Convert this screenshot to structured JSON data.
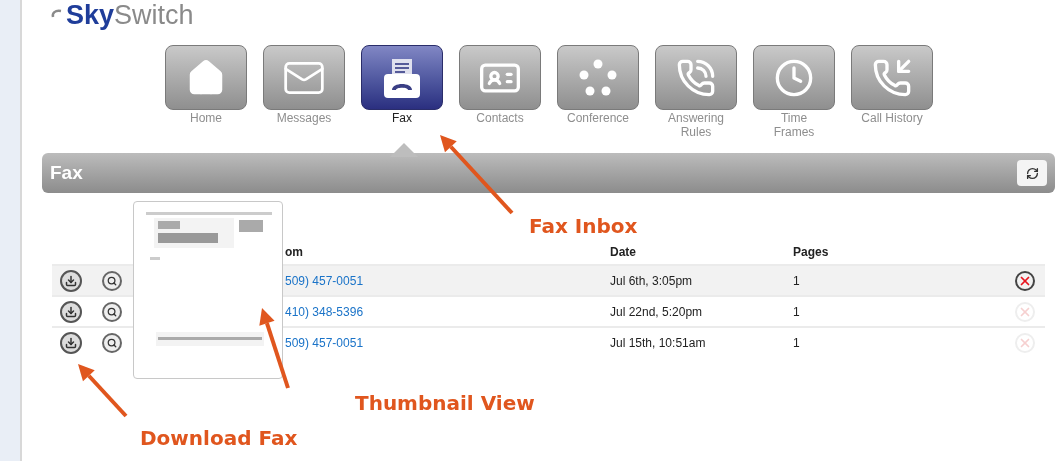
{
  "logo": {
    "brand_bold": "Sky",
    "brand_rest": "Switch"
  },
  "nav": [
    {
      "label": "Home",
      "kind": "home",
      "selected": false
    },
    {
      "label": "Messages",
      "kind": "mail",
      "selected": false
    },
    {
      "label": "Fax",
      "kind": "fax",
      "selected": true
    },
    {
      "label": "Contacts",
      "kind": "contact",
      "selected": false
    },
    {
      "label": "Conference",
      "kind": "conference",
      "selected": false
    },
    {
      "label": "Answering Rules",
      "kind": "answering",
      "selected": false
    },
    {
      "label": "Time Frames",
      "kind": "clock",
      "selected": false
    },
    {
      "label": "Call History",
      "kind": "history",
      "selected": false
    }
  ],
  "panel": {
    "title": "Fax"
  },
  "table": {
    "columns": [
      "om",
      "Date",
      "Pages"
    ],
    "rows": [
      {
        "from": "509) 457-0051",
        "date": "Jul 6th, 3:05pm",
        "pages": "1",
        "selected": true
      },
      {
        "from": "410) 348-5396",
        "date": "Jul 22nd, 5:20pm",
        "pages": "1",
        "selected": false
      },
      {
        "from": "509) 457-0051",
        "date": "Jul 15th, 10:51am",
        "pages": "1",
        "selected": false
      }
    ]
  },
  "annotations": [
    {
      "label": "Fax Inbox"
    },
    {
      "label": "Thumbnail View"
    },
    {
      "label": "Download Fax"
    }
  ]
}
